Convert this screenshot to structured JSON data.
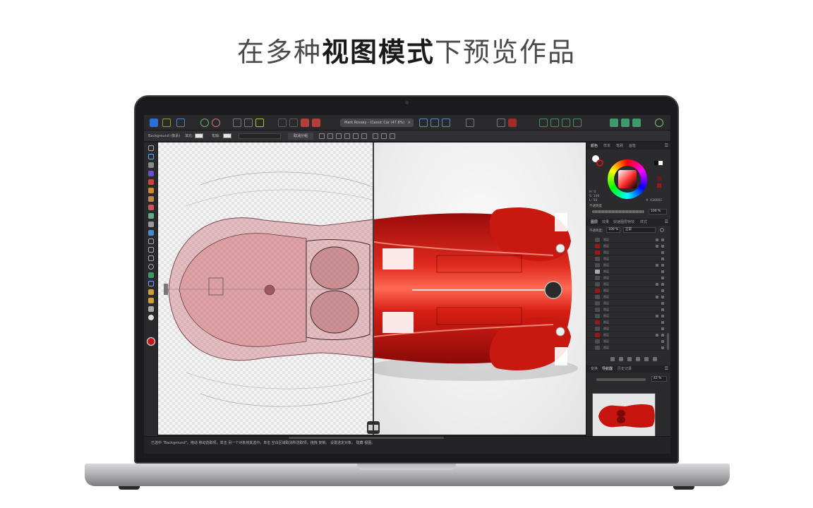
{
  "headline": {
    "part1": "在多种",
    "part2": "视图模式",
    "part3": "下预览作品"
  },
  "app": {
    "document_tab": "Mark Rossey - Classic Car (47.8%)",
    "document_tab_close": "×",
    "context_bar": {
      "layer_label": "Background (像素)",
      "fill_label": "填充:",
      "stroke_label": "笔触:",
      "deselect_button": "取消分组"
    },
    "status_text": "已选中 \"Background\"。拖动 移动选取项。单击 另一个对象将其选中。单击 空白区域取消所选取项。拖拽 复制。 设置选定对象。 隐藏 视图。",
    "colors": {
      "accent_red": "#c21a1a",
      "car_red": "#c8140f",
      "ui_dark": "#2b2b2e"
    }
  },
  "panels": {
    "color": {
      "tabs": [
        "颜色",
        "样本",
        "笔刷",
        "画笔"
      ],
      "hue_readout": "H: 0",
      "sat_readout": "S: 100",
      "lum_readout": "L: 50",
      "hex_label": "#",
      "hex_value": "A30001",
      "opacity_label": "不透明度",
      "opacity_value": "100 %"
    },
    "layers": {
      "tabs": [
        "图层",
        "效果",
        "快速图层特效",
        "样式"
      ],
      "opacity_label": "不透明度:",
      "opacity_value": "100 %",
      "blend_mode": "正常",
      "rows": [
        "图层",
        "图层",
        "图层",
        "图层",
        "图层",
        "图层",
        "图层",
        "图层",
        "图层",
        "图层",
        "图层",
        "图层",
        "图层",
        "图层",
        "图层",
        "图层",
        "图层",
        "图层"
      ]
    },
    "navigator": {
      "tabs": [
        "变换",
        "导航器",
        "历史记录"
      ],
      "zoom_value": "42 %"
    }
  }
}
